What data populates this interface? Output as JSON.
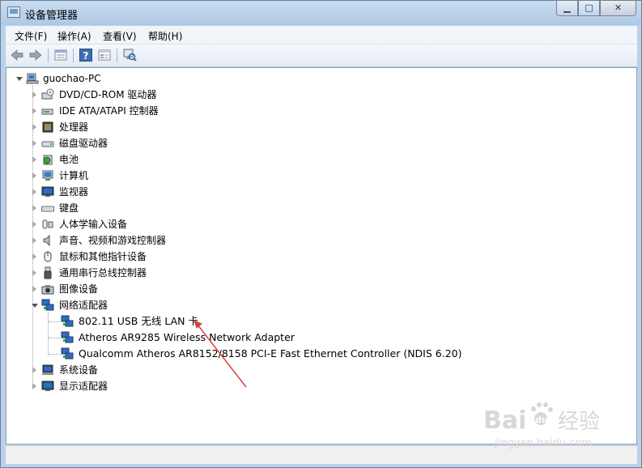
{
  "window": {
    "title": "设备管理器",
    "buttons": {
      "minimize": "▁",
      "maximize": "□",
      "close": "✕"
    }
  },
  "menu": [
    "文件(F)",
    "操作(A)",
    "查看(V)",
    "帮助(H)"
  ],
  "toolbar": {
    "icons": [
      "back-arrow-icon",
      "forward-arrow-icon",
      "properties-icon",
      "help-icon",
      "device-view-icon",
      "scan-hardware-icon"
    ]
  },
  "tree": {
    "root": "guochao-PC",
    "categories": [
      {
        "label": "DVD/CD-ROM 驱动器",
        "icon": "dvd-drive-icon"
      },
      {
        "label": "IDE ATA/ATAPI 控制器",
        "icon": "ide-controller-icon"
      },
      {
        "label": "处理器",
        "icon": "processor-icon"
      },
      {
        "label": "磁盘驱动器",
        "icon": "disk-drive-icon"
      },
      {
        "label": "电池",
        "icon": "battery-icon"
      },
      {
        "label": "计算机",
        "icon": "computer-icon"
      },
      {
        "label": "监视器",
        "icon": "monitor-icon"
      },
      {
        "label": "键盘",
        "icon": "keyboard-icon"
      },
      {
        "label": "人体学输入设备",
        "icon": "hid-icon"
      },
      {
        "label": "声音、视频和游戏控制器",
        "icon": "sound-icon"
      },
      {
        "label": "鼠标和其他指针设备",
        "icon": "mouse-icon"
      },
      {
        "label": "通用串行总线控制器",
        "icon": "usb-icon"
      },
      {
        "label": "图像设备",
        "icon": "camera-icon"
      },
      {
        "label": "网络适配器",
        "icon": "network-adapter-icon",
        "expanded": true,
        "children": [
          "802.11 USB 无线 LAN 卡",
          "Atheros AR9285 Wireless Network Adapter",
          "Qualcomm Atheros AR8152/8158 PCI-E Fast Ethernet Controller (NDIS 6.20)"
        ]
      },
      {
        "label": "系统设备",
        "icon": "system-device-icon"
      },
      {
        "label": "显示适配器",
        "icon": "display-adapter-icon"
      }
    ]
  },
  "watermark": {
    "brand": "Bai",
    "brand2": "du",
    "cn": "经验",
    "url": "jingyan.baidu.com"
  },
  "colors": {
    "title_bar": "#b9d1ea",
    "arrow": "#d9403a"
  }
}
